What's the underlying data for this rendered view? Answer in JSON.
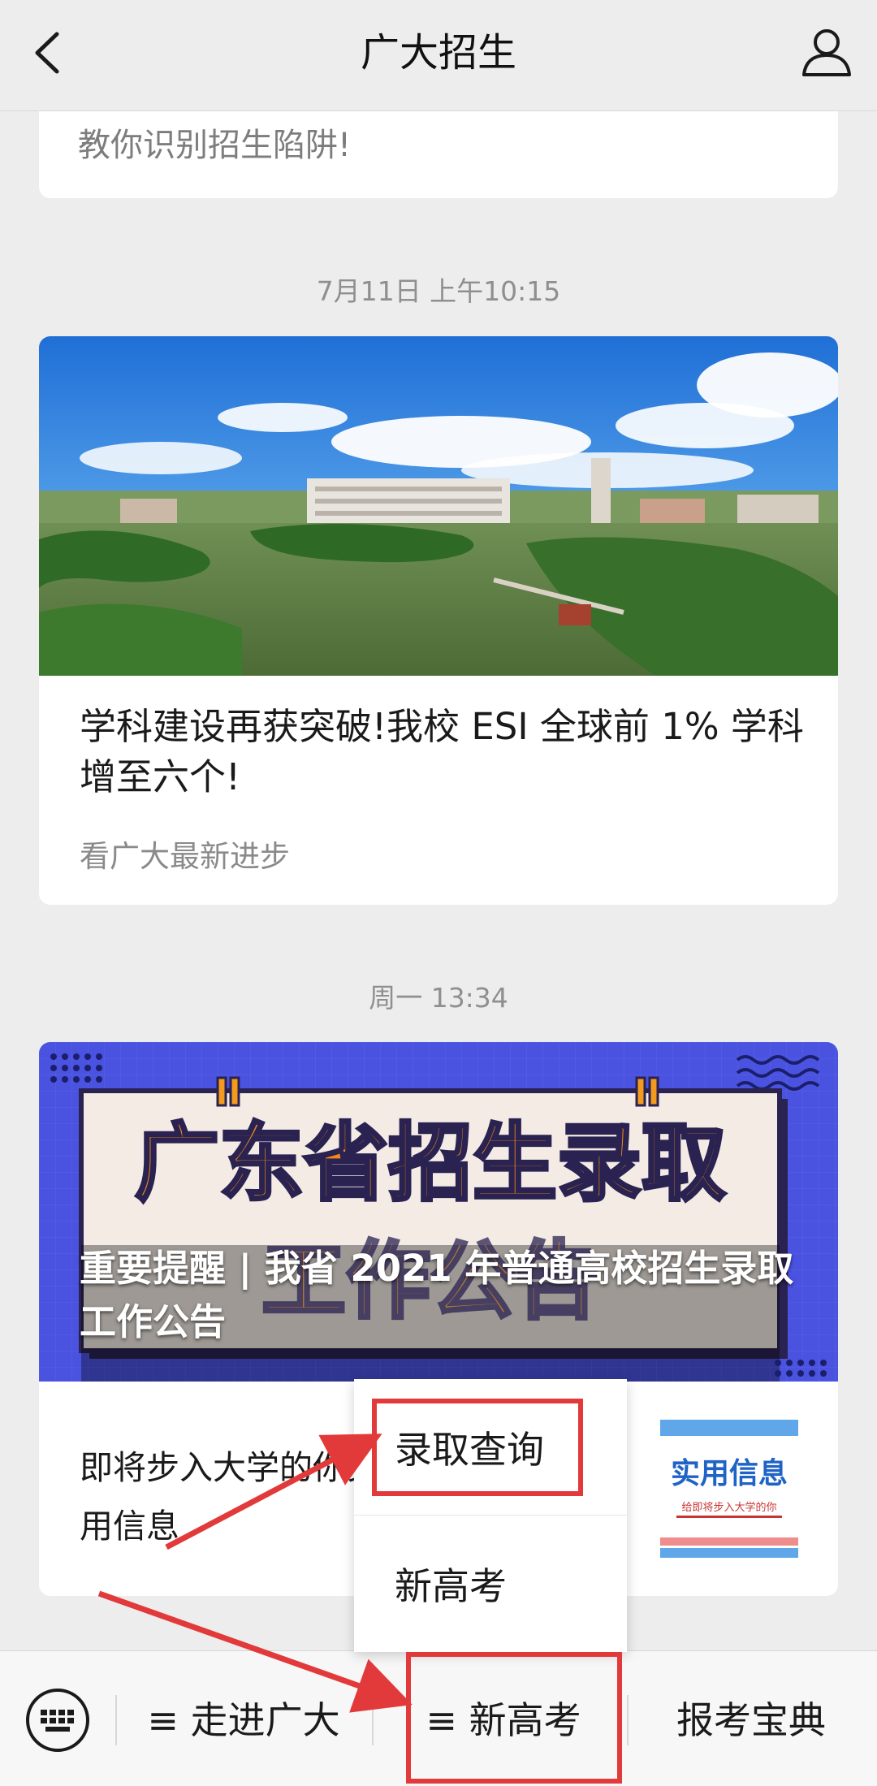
{
  "header": {
    "title": "广大招生",
    "back_icon": "chevron-left-icon",
    "profile_icon": "person-icon"
  },
  "feed": {
    "card1": {
      "snippet": "教你识别招生陷阱!"
    },
    "timestamp1": "7月11日 上午10:15",
    "card2": {
      "headline": "学科建设再获突破!我校 ESI 全球前 1% 学科增至六个!",
      "subline": "看广大最新进步"
    },
    "timestamp2": "周一 13:34",
    "card3": {
      "banner_art_text_line1": "广东省招生录取",
      "banner_art_text_line2": "工作公告",
      "banner_title": "重要提醒 | 我省 2021 年普通高校招生录取工作公告",
      "item_text": "即将步入大学的你实用信息",
      "thumb_title": "实用信息",
      "thumb_subtitle": "给即将步入大学的你"
    }
  },
  "popup_menu": {
    "items": [
      "录取查询",
      "新高考"
    ]
  },
  "bottom_bar": {
    "keyboard_icon": "keyboard-icon",
    "menu1": "≡ 走进广大",
    "menu2": "≡ 新高考",
    "menu3": "报考宝典"
  },
  "colors": {
    "annotation_red": "#e23a3a",
    "background": "#ededed"
  }
}
